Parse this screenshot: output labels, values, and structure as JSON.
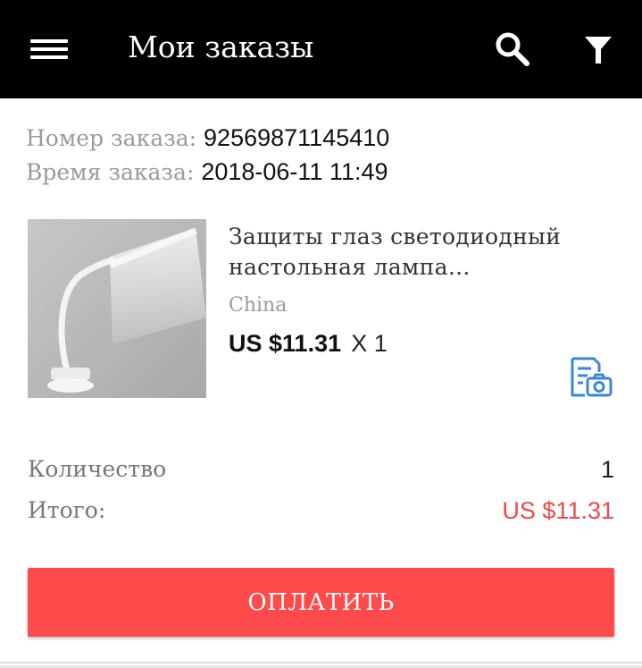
{
  "header": {
    "title": "Мои заказы",
    "menu_icon": "hamburger-menu-icon",
    "search_icon": "search-icon",
    "filter_icon": "filter-icon",
    "background_color": "#000000"
  },
  "order": {
    "number_label": "Номер заказа:",
    "number_value": "92569871145410",
    "time_label": "Время заказа:",
    "time_value": "2018-06-11 11:49",
    "product": {
      "name_line1": "Защиты глаз светодиодный",
      "name_line2": "настольная лампа...",
      "origin": "China",
      "price": "US $11.31",
      "quantity": "X 1",
      "image_icon": "desk-lamp-image",
      "action_icon": "review-with-photo-icon"
    },
    "summary": {
      "quantity_label": "Количество",
      "quantity_value": "1",
      "total_label": "Итого:",
      "total_value": "US $11.31"
    },
    "pay_button_label": "ОПЛАТИТЬ"
  },
  "colors": {
    "accent": "#ff4b4b",
    "total_price": "#f04848",
    "icon_blue": "#3b86d6"
  }
}
